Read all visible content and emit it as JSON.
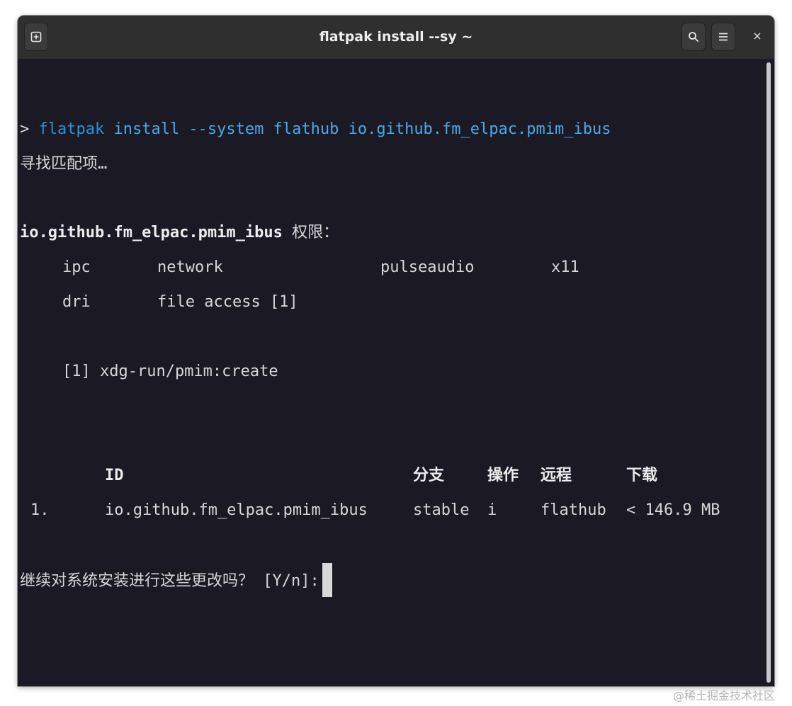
{
  "window": {
    "title": "flatpak install --sy ~"
  },
  "headerbar": {
    "new_tab_icon": "new-tab-icon",
    "search_icon": "search-icon",
    "menu_icon": "hamburger-menu-icon",
    "close_label": "×"
  },
  "terminal": {
    "prompt_symbol": ">",
    "command_word": "flatpak",
    "command_rest": "install --system flathub io.github.fm_elpac.pmim_ibus",
    "searching_line": "寻找匹配项…",
    "permissions_app": "io.github.fm_elpac.pmim_ibus",
    "permissions_label": "权限：",
    "permissions": [
      [
        "ipc",
        "network",
        "pulseaudio",
        "x11"
      ],
      [
        "dri",
        "file access [1]"
      ]
    ],
    "footnote": "[1] xdg-run/pmim:create",
    "table": {
      "headers": [
        "ID",
        "分支",
        "操作",
        "远程",
        "下载"
      ],
      "rows": [
        {
          "index": "1.",
          "id": "io.github.fm_elpac.pmim_ibus",
          "branch": "stable",
          "op": "i",
          "remote": "flathub",
          "download": "< 146.9 MB"
        }
      ]
    },
    "confirm_prompt": "继续对系统安装进行这些更改吗？ [Y/n]:"
  },
  "watermark": "@稀土掘金技术社区",
  "colors": {
    "terminal_bg": "#1b1a24",
    "command_blue": "#2b8fd8",
    "text": "#d6d6d6"
  }
}
